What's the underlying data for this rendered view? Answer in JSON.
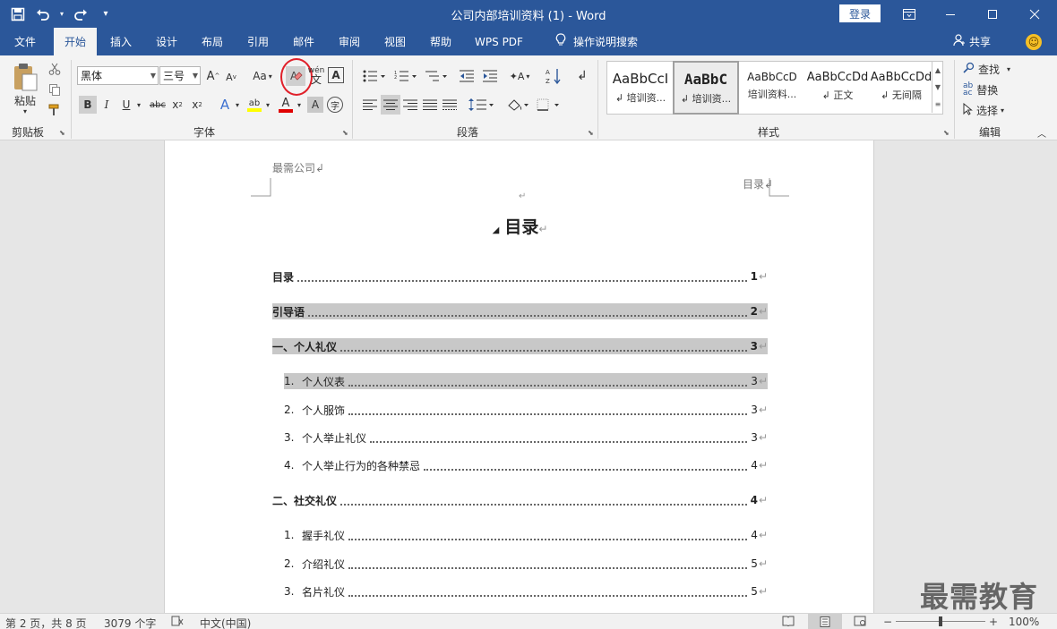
{
  "title_bar": {
    "title": "公司内部培训资料 (1)  -  Word",
    "login_label": "登录",
    "qat_icons": [
      "save-icon",
      "undo-icon",
      "redo-icon",
      "customize-qat-icon"
    ],
    "window_icons": [
      "ribbon-display-options-icon",
      "minimize-icon",
      "maximize-icon",
      "close-icon"
    ]
  },
  "tabs": [
    {
      "label": "文件"
    },
    {
      "label": "开始"
    },
    {
      "label": "插入"
    },
    {
      "label": "设计"
    },
    {
      "label": "布局"
    },
    {
      "label": "引用"
    },
    {
      "label": "邮件"
    },
    {
      "label": "审阅"
    },
    {
      "label": "视图"
    },
    {
      "label": "帮助"
    },
    {
      "label": "WPS PDF"
    }
  ],
  "tell_me": "操作说明搜索",
  "share_label": "共享",
  "ribbon": {
    "clipboard": {
      "paste_label": "粘贴",
      "group_label": "剪贴板"
    },
    "font": {
      "font_name": "黑体",
      "font_size": "三号",
      "case_label": "Aa",
      "group_label": "字体",
      "phonetic": "wén"
    },
    "paragraph": {
      "group_label": "段落"
    },
    "styles": {
      "group_label": "样式",
      "items": [
        {
          "preview": "AaBbCcI",
          "name": "↲ 培训资..."
        },
        {
          "preview": "AaBbC",
          "name": "↲ 培训资..."
        },
        {
          "preview": "AaBbCcD",
          "name": "培训资料..."
        },
        {
          "preview": "AaBbCcDd",
          "name": "↲ 正文"
        },
        {
          "preview": "AaBbCcDd",
          "name": "↲ 无间隔"
        }
      ]
    },
    "editing": {
      "find_label": "查找",
      "replace_label": "替换",
      "select_label": "选择",
      "group_label": "编辑"
    }
  },
  "document": {
    "header_left": "最需公司↲",
    "header_right": "目录↲",
    "title": "目录",
    "toc": [
      {
        "num": "",
        "text": "目录",
        "page": "1",
        "level": 1,
        "hl": false
      },
      {
        "num": "",
        "text": "引导语",
        "page": "2",
        "level": 1,
        "hl": true
      },
      {
        "num": "",
        "text": "一、个人礼仪",
        "page": "3",
        "level": 1,
        "hl": true
      },
      {
        "num": "1.",
        "text": "个人仪表",
        "page": "3",
        "level": 2,
        "hl": true
      },
      {
        "num": "2.",
        "text": "个人服饰",
        "page": "3",
        "level": 2,
        "hl": false
      },
      {
        "num": "3.",
        "text": "个人举止礼仪",
        "page": "3",
        "level": 2,
        "hl": false
      },
      {
        "num": "4.",
        "text": "个人举止行为的各种禁忌",
        "page": "4",
        "level": 2,
        "hl": false
      },
      {
        "num": "",
        "text": "二、社交礼仪",
        "page": "4",
        "level": 1,
        "hl": false
      },
      {
        "num": "1.",
        "text": "握手礼仪",
        "page": "4",
        "level": 2,
        "hl": false
      },
      {
        "num": "2.",
        "text": "介绍礼仪",
        "page": "5",
        "level": 2,
        "hl": false
      },
      {
        "num": "3.",
        "text": "名片礼仪",
        "page": "5",
        "level": 2,
        "hl": false
      }
    ]
  },
  "watermark": "最需教育",
  "status": {
    "page_info": "第 2 页，共 8 页",
    "word_count": "3079 个字",
    "language": "中文(中国)",
    "zoom": "100%"
  },
  "colors": {
    "accent": "#2b579a",
    "highlight_circle": "#e0202a"
  }
}
